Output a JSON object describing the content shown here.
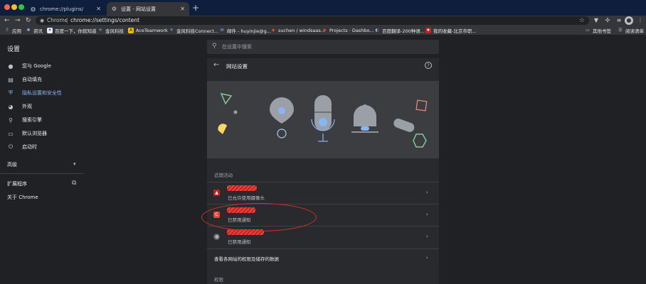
{
  "tabs": [
    {
      "title": "chrome://plugins/",
      "icon": "globe-icon"
    },
    {
      "title": "设置 - 网站设置",
      "icon": "gear-icon"
    }
  ],
  "toolbar": {
    "omnibox_label": "Chrome",
    "url": "chrome://settings/content"
  },
  "bookmarks": [
    {
      "label": "应用",
      "icon": "apps-grid-icon",
      "color": "#8ab4f8"
    },
    {
      "label": "资讯",
      "icon": "news-icon",
      "color": "#8ab4f8"
    },
    {
      "label": "百度一下，你就知道",
      "icon": "baidu-icon",
      "color": "#e8eaed"
    },
    {
      "label": "金风科技",
      "icon": "goldwind-icon",
      "color": "#8ab4f8"
    },
    {
      "label": "AceTeamwork",
      "icon": "aceteamwork-icon",
      "color": "#fbbc04"
    },
    {
      "label": "金风科技Connect...",
      "icon": "goldwind-icon",
      "color": "#8ab4f8"
    },
    {
      "label": "邮件 - huyinjie@g...",
      "icon": "mail-icon",
      "color": "#8ab4f8"
    },
    {
      "label": "suchen / windsaas...",
      "icon": "gitlab-icon",
      "color": "#e24329"
    },
    {
      "label": "Projects · Dashbo...",
      "icon": "gitlab-icon",
      "color": "#e24329"
    },
    {
      "label": "百度翻译-200种语...",
      "icon": "translate-icon",
      "color": "#8ab4f8"
    },
    {
      "label": "我的收藏-北京市职...",
      "icon": "favorites-icon",
      "color": "#c5221f"
    },
    {
      "label": "其他书签",
      "icon": "folder-icon",
      "color": "#bdc1c6"
    },
    {
      "label": "阅读清单",
      "icon": "reading-list-icon",
      "color": "#bdc1c6"
    }
  ],
  "settings": {
    "title": "设置",
    "search_placeholder": "在设置中搜索"
  },
  "sidebar": {
    "items": [
      {
        "label": "您与 Google",
        "icon": "person-icon"
      },
      {
        "label": "自动填充",
        "icon": "autofill-icon"
      },
      {
        "label": "隐私设置和安全性",
        "icon": "shield-icon"
      },
      {
        "label": "外观",
        "icon": "palette-icon"
      },
      {
        "label": "搜索引擎",
        "icon": "search-icon"
      },
      {
        "label": "默认浏览器",
        "icon": "browser-icon"
      },
      {
        "label": "启动时",
        "icon": "power-icon"
      }
    ],
    "advanced": "高级",
    "extensions": "扩展程序",
    "about": "关于 Chrome"
  },
  "main": {
    "title": "网站设置",
    "recent_label": "近期活动",
    "recent": [
      {
        "subtitle": "已允许使用摄像头",
        "icon": "site-favicon",
        "color": "#c5221f"
      },
      {
        "subtitle": "已禁用通知",
        "icon": "site-favicon",
        "color": "#e8453c"
      },
      {
        "subtitle": "已禁用通知",
        "icon": "globe-icon",
        "color": "#5f6368"
      }
    ],
    "all_sites_link": "查看各网站的权限及储存的数据",
    "permissions_label": "权限"
  },
  "colors": {
    "accent": "#8ab4f8",
    "annotation": "#d93025"
  }
}
